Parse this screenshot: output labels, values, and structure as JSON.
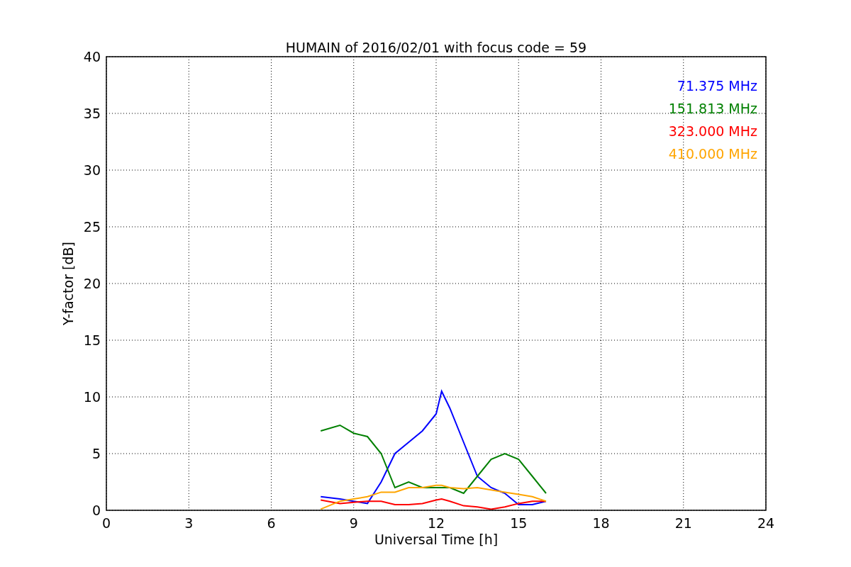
{
  "figure": {
    "chart_data": {
      "type": "line",
      "title": "HUMAIN of 2016/02/01 with focus code = 59",
      "xlabel": "Universal Time [h]",
      "ylabel": "Y-factor [dB]",
      "x": [
        7.8,
        8.5,
        9,
        9.5,
        10,
        10.5,
        11,
        11.5,
        12,
        12.2,
        12.5,
        13,
        13.5,
        14,
        14.5,
        15,
        15.5,
        16
      ],
      "series": [
        {
          "name": "71.375 MHz",
          "color": "#0000ff",
          "values": [
            1.2,
            1.0,
            0.8,
            0.6,
            2.5,
            5,
            6,
            7,
            8.5,
            10.5,
            9,
            6,
            3,
            2,
            1.5,
            0.5,
            0.5,
            0.8
          ]
        },
        {
          "name": "151.813 MHz",
          "color": "#008000",
          "values": [
            7,
            7.5,
            6.8,
            6.5,
            5,
            2,
            2.5,
            2,
            2,
            2,
            2,
            1.5,
            3,
            4.5,
            5,
            4.5,
            3,
            1.5
          ]
        },
        {
          "name": "323.000 MHz",
          "color": "#ff0000",
          "values": [
            0.9,
            0.6,
            0.7,
            0.8,
            0.8,
            0.5,
            0.5,
            0.6,
            0.9,
            1,
            0.8,
            0.4,
            0.3,
            0.1,
            0.3,
            0.6,
            0.8,
            0.8
          ]
        },
        {
          "name": "410.000 MHz",
          "color": "#ffa500",
          "values": [
            0.1,
            0.8,
            1,
            1.2,
            1.6,
            1.6,
            2,
            2,
            2.2,
            2.2,
            2,
            1.9,
            2,
            1.8,
            1.6,
            1.4,
            1.2,
            0.8
          ]
        }
      ],
      "grid": true,
      "xlim": [
        0,
        24
      ],
      "ylim": [
        0,
        40
      ],
      "xticks": [
        0,
        3,
        6,
        9,
        12,
        15,
        18,
        21,
        24
      ],
      "yticks": [
        0,
        5,
        10,
        15,
        20,
        25,
        30,
        35,
        40
      ]
    }
  }
}
